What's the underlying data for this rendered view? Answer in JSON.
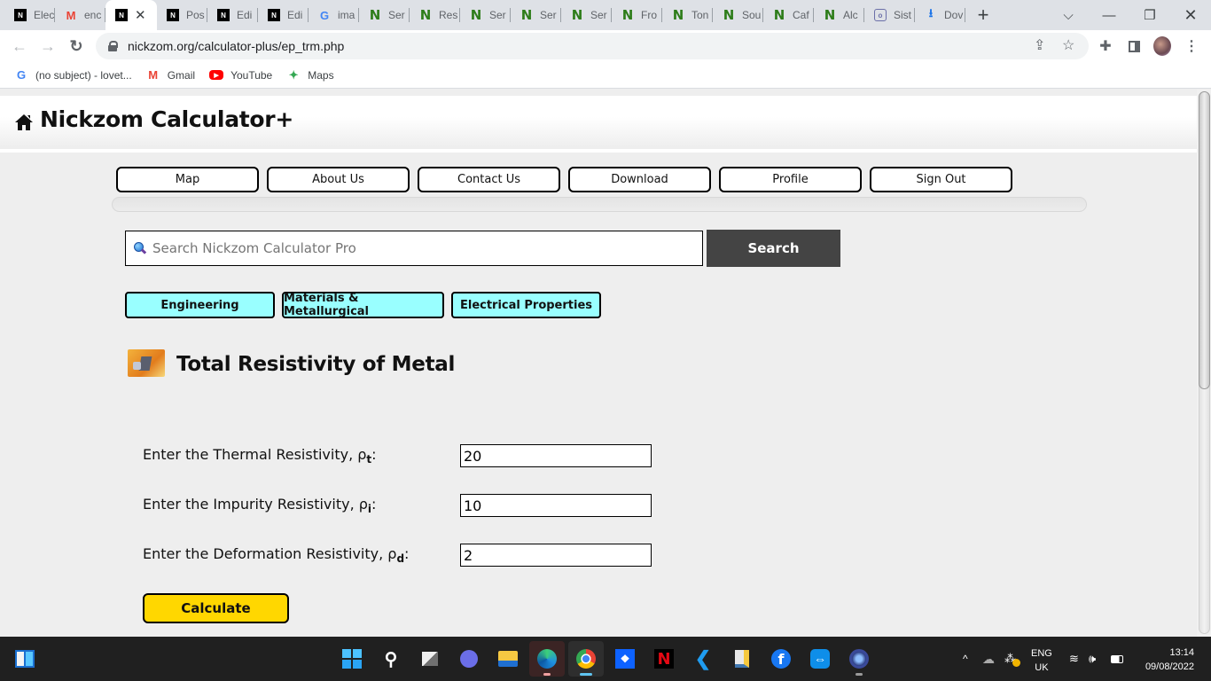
{
  "browser": {
    "tabs": [
      {
        "icon": "nickzom-favicon",
        "title": "Elec",
        "active": false
      },
      {
        "icon": "gmail-favicon",
        "title": "enc",
        "active": false
      },
      {
        "icon": "nickzom-favicon",
        "title": "",
        "active": true
      },
      {
        "icon": "nickzom-favicon",
        "title": "Pos",
        "active": false
      },
      {
        "icon": "nickzom-favicon",
        "title": "Edi",
        "active": false
      },
      {
        "icon": "nickzom-favicon",
        "title": "Edi",
        "active": false
      },
      {
        "icon": "google-favicon",
        "title": "ima",
        "active": false
      },
      {
        "icon": "n-favicon",
        "title": "Ser",
        "active": false
      },
      {
        "icon": "n-favicon",
        "title": "Res",
        "active": false
      },
      {
        "icon": "n-favicon",
        "title": "Ser",
        "active": false
      },
      {
        "icon": "n-favicon",
        "title": "Ser",
        "active": false
      },
      {
        "icon": "n-favicon",
        "title": "Ser",
        "active": false
      },
      {
        "icon": "n-favicon",
        "title": "Fro",
        "active": false
      },
      {
        "icon": "n-favicon",
        "title": "Ton",
        "active": false
      },
      {
        "icon": "n-favicon",
        "title": "Sou",
        "active": false
      },
      {
        "icon": "n-favicon",
        "title": "Caf",
        "active": false
      },
      {
        "icon": "n-favicon",
        "title": "Alc",
        "active": false
      },
      {
        "icon": "sist-favicon",
        "title": "Sist",
        "active": false
      },
      {
        "icon": "download-favicon",
        "title": "Dov",
        "active": false
      }
    ],
    "url": "nickzom.org/calculator-plus/ep_trm.php",
    "bookmarks": [
      {
        "icon": "google-icon",
        "label": "(no subject) - lovet..."
      },
      {
        "icon": "gmail-icon",
        "label": "Gmail"
      },
      {
        "icon": "youtube-icon",
        "label": "YouTube"
      },
      {
        "icon": "maps-icon",
        "label": "Maps"
      }
    ]
  },
  "site": {
    "title": "Nickzom Calculator+",
    "nav": [
      "Map",
      "About Us",
      "Contact Us",
      "Download",
      "Profile",
      "Sign Out"
    ],
    "search": {
      "placeholder": "Search Nickzom Calculator Pro",
      "value": "",
      "button": "Search"
    },
    "breadcrumbs": [
      "Engineering",
      "Materials & Metallurgical",
      "Electrical Properties"
    ]
  },
  "calculator": {
    "title": "Total Resistivity of Metal",
    "fields": [
      {
        "label": "Enter the Thermal Resistivity, ρ",
        "subscript": "t",
        "suffix": ":",
        "value": "20"
      },
      {
        "label": "Enter the Impurity Resistivity, ρ",
        "subscript": "i",
        "suffix": ":",
        "value": "10"
      },
      {
        "label": "Enter the Deformation Resistivity, ρ",
        "subscript": "d",
        "suffix": ":",
        "value": "2"
      }
    ],
    "calculate_label": "Calculate"
  },
  "taskbar": {
    "apps": [
      "start",
      "search",
      "task-view",
      "teams-chat",
      "file-explorer",
      "edge",
      "chrome",
      "dropbox",
      "netflix",
      "vscode",
      "python-file",
      "facebook",
      "teamviewer",
      "app"
    ],
    "language": "ENG",
    "region": "UK",
    "time": "13:14",
    "date": "09/08/2022"
  }
}
